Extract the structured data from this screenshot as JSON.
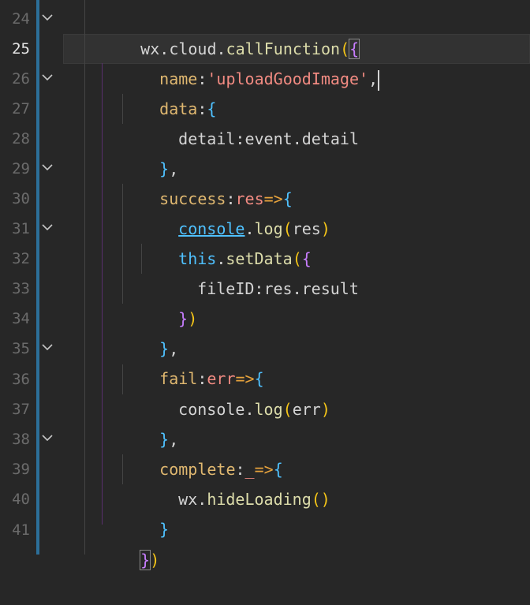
{
  "editor": {
    "active_line": 25,
    "lines": [
      {
        "num": "24",
        "fold": true
      },
      {
        "num": "25",
        "fold": false
      },
      {
        "num": "26",
        "fold": true
      },
      {
        "num": "27",
        "fold": false
      },
      {
        "num": "28",
        "fold": false
      },
      {
        "num": "29",
        "fold": true
      },
      {
        "num": "30",
        "fold": false
      },
      {
        "num": "31",
        "fold": true
      },
      {
        "num": "32",
        "fold": false
      },
      {
        "num": "33",
        "fold": false
      },
      {
        "num": "34",
        "fold": false
      },
      {
        "num": "35",
        "fold": true
      },
      {
        "num": "36",
        "fold": false
      },
      {
        "num": "37",
        "fold": false
      },
      {
        "num": "38",
        "fold": true
      },
      {
        "num": "39",
        "fold": false
      },
      {
        "num": "40",
        "fold": false
      },
      {
        "num": "41",
        "fold": false
      }
    ],
    "code": {
      "l24": {
        "a": "wx",
        "b": ".",
        "c": "cloud",
        "d": ".",
        "e": "callFunction",
        "f": "(",
        "g": "{"
      },
      "l25": {
        "a": "name",
        "b": ":",
        "c": "'uploadGoodImage'",
        "d": ","
      },
      "l26": {
        "a": "data",
        "b": ":",
        "c": "{"
      },
      "l27": {
        "a": "detail",
        "b": ":",
        "c": "event",
        "d": ".",
        "e": "detail"
      },
      "l28": {
        "a": "}",
        "b": ","
      },
      "l29": {
        "a": "success",
        "b": ":",
        "c": "res",
        "d": "=>",
        "e": "{"
      },
      "l30": {
        "a": "console",
        "b": ".",
        "c": "log",
        "d": "(",
        "e": "res",
        "f": ")"
      },
      "l31": {
        "a": "this",
        "b": ".",
        "c": "setData",
        "d": "(",
        "e": "{"
      },
      "l32": {
        "a": "fileID",
        "b": ":",
        "c": "res",
        "d": ".",
        "e": "result"
      },
      "l33": {
        "a": "}",
        "b": ")"
      },
      "l34": {
        "a": "}",
        "b": ","
      },
      "l35": {
        "a": "fail",
        "b": ":",
        "c": "err",
        "d": "=>",
        "e": "{"
      },
      "l36": {
        "a": "console",
        "b": ".",
        "c": "log",
        "d": "(",
        "e": "err",
        "f": ")"
      },
      "l37": {
        "a": "}",
        "b": ","
      },
      "l38": {
        "a": "complete",
        "b": ":",
        "c": "_",
        "d": "=>",
        "e": "{"
      },
      "l39": {
        "a": "wx",
        "b": ".",
        "c": "hideLoading",
        "d": "()"
      },
      "l40": {
        "a": "}"
      },
      "l41": {
        "a": "}",
        "b": ")"
      }
    },
    "colors": {
      "background": "#272727",
      "gutter_text": "#6b6b6b",
      "git_bar": "#2c6f99",
      "string": "#f28b82",
      "function": "#dcdcaa",
      "property": "#e0b870",
      "keyword": "#4fc1ff"
    }
  }
}
